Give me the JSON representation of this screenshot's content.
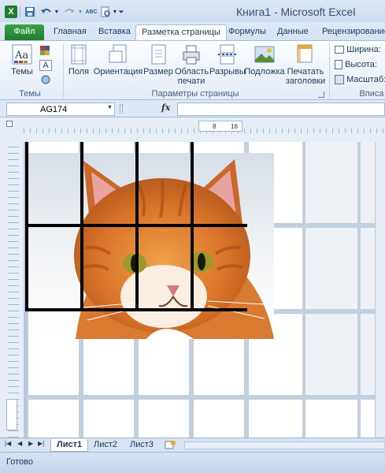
{
  "title": "Книга1  -  Microsoft Excel",
  "quick_access": {
    "excel_icon": "excel-logo-icon",
    "save": "save-icon",
    "undo": "undo-icon",
    "redo": "redo-icon",
    "spell": "spelling-icon",
    "preview": "print-preview-icon"
  },
  "tabs": [
    {
      "label": "Файл"
    },
    {
      "label": "Главная"
    },
    {
      "label": "Вставка"
    },
    {
      "label": "Разметка страницы"
    },
    {
      "label": "Формулы"
    },
    {
      "label": "Данные"
    },
    {
      "label": "Рецензирование"
    }
  ],
  "ribbon": {
    "themes": {
      "label": "Темы",
      "group": "Темы"
    },
    "page_setup": {
      "group": "Параметры страницы",
      "margins": "Поля",
      "orientation": "Ориентация",
      "size": "Размер",
      "print_area_1": "Область",
      "print_area_2": "печати",
      "breaks": "Разрывы",
      "background": "Подложка",
      "print_titles_1": "Печатать",
      "print_titles_2": "заголовки"
    },
    "fit": {
      "width": "Ширина:",
      "height": "Высота:",
      "scale": "Масштаб:",
      "group": "Вписа"
    }
  },
  "formula_bar": {
    "name_box": "AG174",
    "fx": "fx",
    "value": ""
  },
  "ruler": {
    "left": "8",
    "right": "16"
  },
  "sheet_tabs": [
    {
      "label": "Лист1"
    },
    {
      "label": "Лист2"
    },
    {
      "label": "Лист3"
    }
  ],
  "status": {
    "ready": "Готово"
  },
  "colors": {
    "accent": "#1f7d2f",
    "ribbon_bg": "#e4ecf7",
    "frame": "#a7bcd6"
  }
}
